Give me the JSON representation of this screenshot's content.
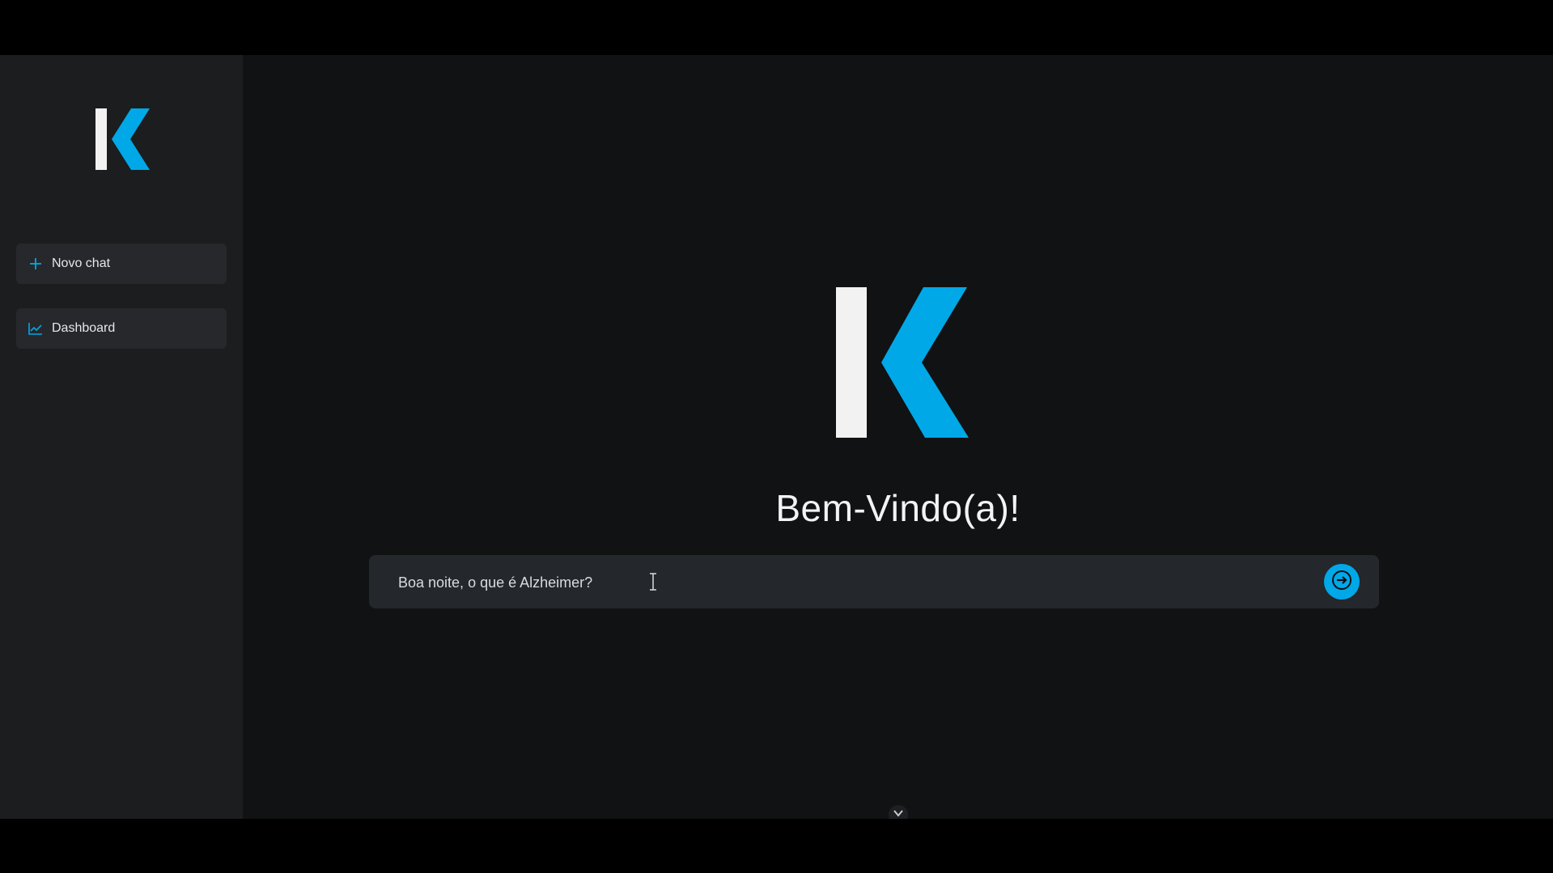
{
  "brand": {
    "logo_letter": "K",
    "accent_color": "#00a8e8",
    "logo_bar_color": "#f2f2f2"
  },
  "sidebar": {
    "items": [
      {
        "label": "Novo chat",
        "icon": "plus-icon"
      },
      {
        "label": "Dashboard",
        "icon": "line-chart-icon"
      }
    ]
  },
  "main": {
    "welcome_title": "Bem-Vindo(a)!",
    "chat_input": {
      "value": "Boa noite, o que é Alzheimer?"
    },
    "send_icon": "arrow-right-icon",
    "scroll_icon": "chevron-down-icon"
  }
}
